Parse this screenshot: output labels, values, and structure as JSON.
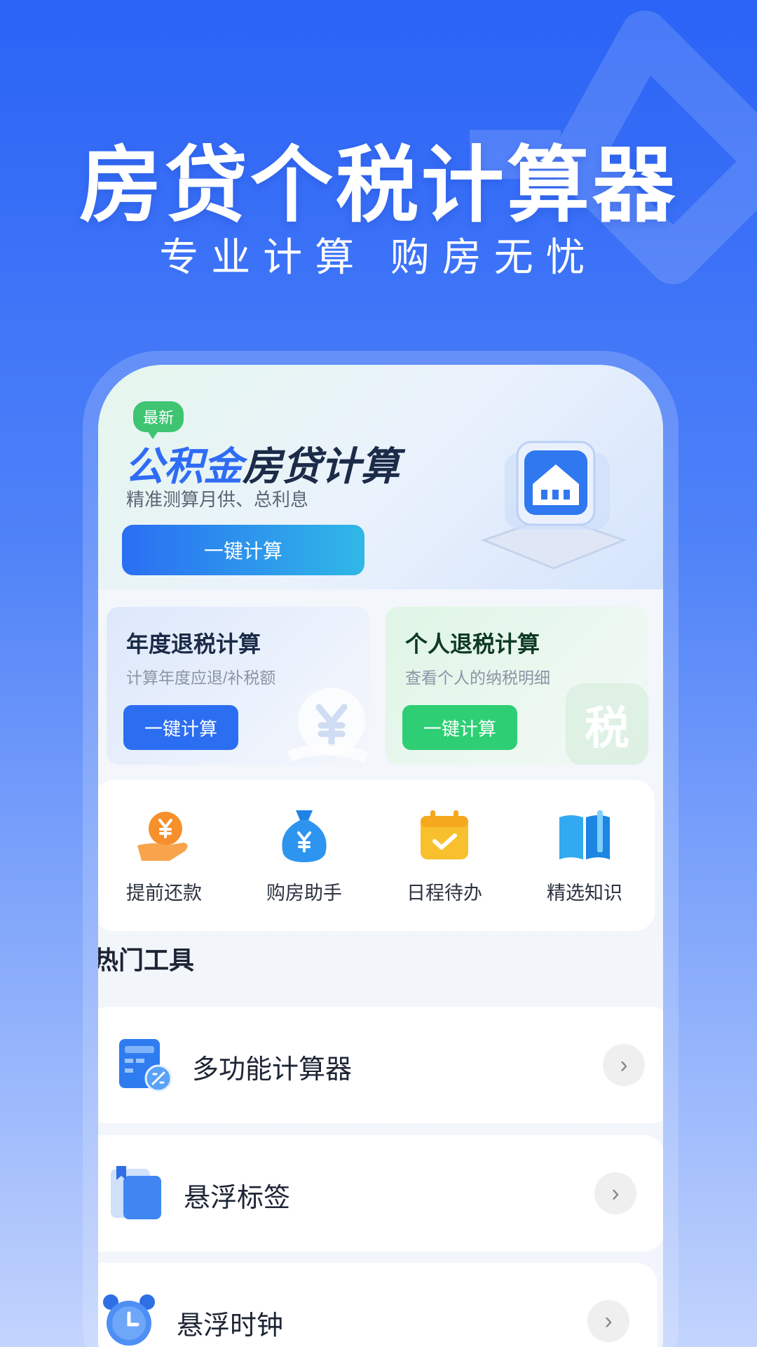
{
  "header": {
    "title": "房贷个税计算器",
    "tagline": "专业计算 购房无忧"
  },
  "hero": {
    "badge": "最新",
    "title_highlight": "公积金",
    "title_rest": "房贷计算",
    "subtitle": "精准测算月供、总利息",
    "button": "一键计算",
    "icon": "house-icon"
  },
  "cards": [
    {
      "title": "年度退税计算",
      "subtitle": "计算年度应退/补税额",
      "button": "一键计算",
      "watermark": "yen-icon"
    },
    {
      "title": "个人退税计算",
      "subtitle": "查看个人的纳税明细",
      "button": "一键计算",
      "watermark_text": "税"
    }
  ],
  "quick": [
    {
      "label": "提前还款",
      "icon": "yen-hand-icon"
    },
    {
      "label": "购房助手",
      "icon": "money-bag-icon"
    },
    {
      "label": "日程待办",
      "icon": "calendar-check-icon"
    },
    {
      "label": "精选知识",
      "icon": "book-icon"
    }
  ],
  "section": {
    "title": "热门工具"
  },
  "tools": [
    {
      "label": "多功能计算器",
      "icon": "calculator-icon"
    },
    {
      "label": "悬浮标签",
      "icon": "bookmark-card-icon"
    },
    {
      "label": "悬浮时钟",
      "icon": "alarm-clock-icon"
    }
  ],
  "colors": {
    "primary": "#2c6ef2",
    "green": "#2ecf74",
    "badge": "#3fc472"
  }
}
